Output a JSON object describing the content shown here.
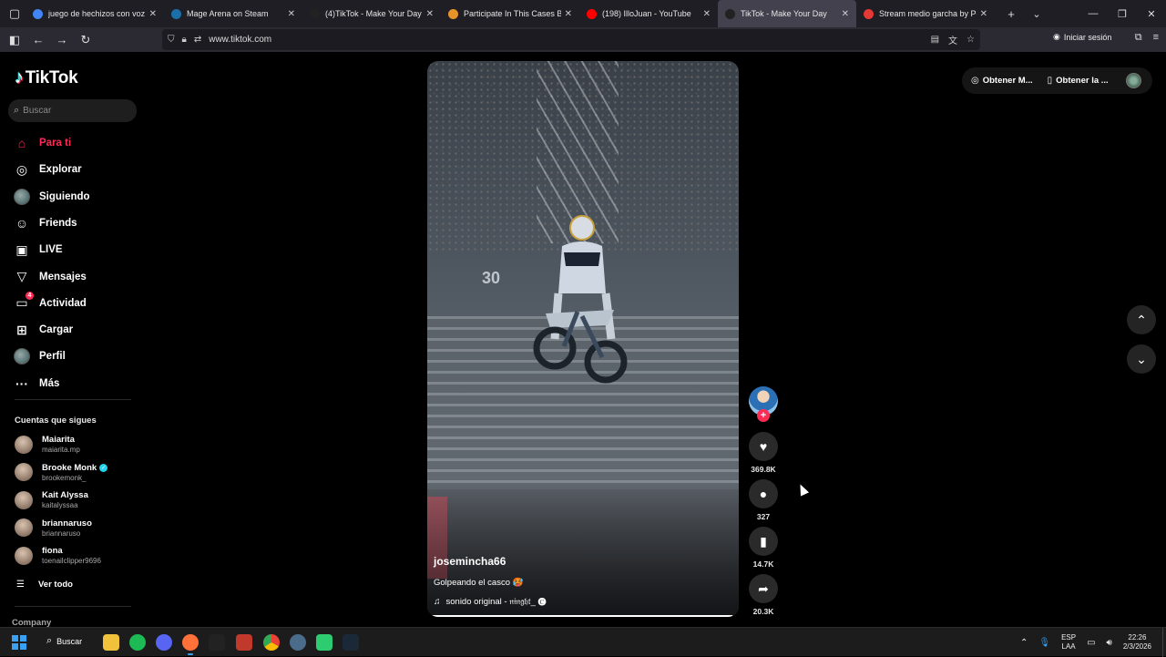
{
  "browser": {
    "tabs": [
      {
        "title": "juego de hechizos con voz - Bu",
        "favicon": "google-icon",
        "color": "#4285f4",
        "active": false
      },
      {
        "title": "Mage Arena on Steam",
        "favicon": "steam-icon",
        "color": "#1b6fa8",
        "active": false
      },
      {
        "title": "(4)TikTok - Make Your Day",
        "favicon": "tiktok-icon",
        "color": "#222222",
        "active": false
      },
      {
        "title": "Participate In This Cases Battle!",
        "favicon": "diamond-icon",
        "color": "#e8922a",
        "active": false
      },
      {
        "title": "(198) IlloJuan - YouTube",
        "favicon": "youtube-icon",
        "color": "#ff0000",
        "active": false
      },
      {
        "title": "TikTok - Make Your Day",
        "favicon": "tiktok-icon",
        "color": "#222222",
        "active": true
      },
      {
        "title": "Stream medio garcha by PelisC",
        "favicon": "stream-icon",
        "color": "#e53935",
        "active": false
      }
    ],
    "url": "www.tiktok.com",
    "signin_label": "Iniciar sesión"
  },
  "sidebar": {
    "logo": "TikTok",
    "search_placeholder": "Buscar",
    "menu": [
      {
        "label": "Para ti",
        "icon": "home-icon",
        "glyph": "⌂",
        "active": true
      },
      {
        "label": "Explorar",
        "icon": "compass-icon",
        "glyph": "◎",
        "active": false
      },
      {
        "label": "Siguiendo",
        "icon": "following-avatar-icon",
        "glyph": "",
        "active": false
      },
      {
        "label": "Friends",
        "icon": "friends-icon",
        "glyph": "☺",
        "active": false
      },
      {
        "label": "LIVE",
        "icon": "live-icon",
        "glyph": "▣",
        "active": false
      },
      {
        "label": "Mensajes",
        "icon": "messages-icon",
        "glyph": "▽",
        "active": false
      },
      {
        "label": "Actividad",
        "icon": "activity-icon",
        "glyph": "▭",
        "active": false,
        "badge": "4"
      },
      {
        "label": "Cargar",
        "icon": "upload-icon",
        "glyph": "⊞",
        "active": false
      },
      {
        "label": "Perfil",
        "icon": "profile-icon",
        "glyph": "",
        "active": false
      },
      {
        "label": "Más",
        "icon": "more-icon",
        "glyph": "···",
        "active": false
      }
    ],
    "following_title": "Cuentas que sigues",
    "accounts": [
      {
        "name": "Maiarita",
        "username": "maiarita.mp",
        "verified": false
      },
      {
        "name": "Brooke Monk",
        "username": "brookemonk_",
        "verified": true
      },
      {
        "name": "Kait Alyssa",
        "username": "kaitalyssaa",
        "verified": false
      },
      {
        "name": "briannaruso",
        "username": "briannaruso",
        "verified": false
      },
      {
        "name": "fiona",
        "username": "toenailclipper9696",
        "verified": false
      }
    ],
    "see_all": "Ver todo",
    "company": "Company"
  },
  "video": {
    "author": "josemincha66",
    "caption": "Golpeando el casco 🥵",
    "sound": "sonido original - 𝔫𝔦𝔫𝔤𝔥𝔱_ 🅒",
    "progress": 0.98,
    "board_text": "30"
  },
  "actions": {
    "likes": "369.8K",
    "comments": "327",
    "saves": "14.7K",
    "shares": "20.3K"
  },
  "topright": {
    "coins_label": "Obtener M...",
    "app_label": "Obtener la ..."
  },
  "taskbar": {
    "search_label": "Buscar",
    "lang_top": "ESP",
    "lang_bottom": "LAA",
    "time": "22:26",
    "date": "2/3/2026"
  }
}
